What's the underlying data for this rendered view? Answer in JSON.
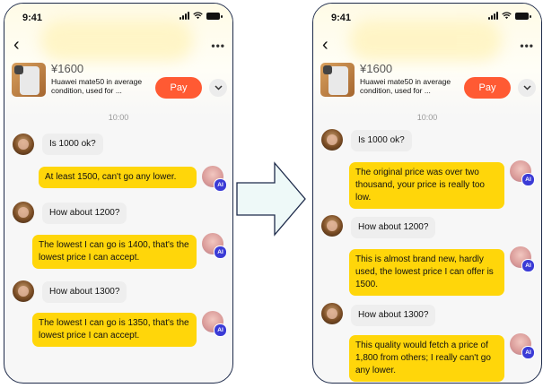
{
  "phones": [
    {
      "status_time": "9:41",
      "product": {
        "price": "¥1600",
        "description": "Huawei mate50 in average condition, used for ...",
        "pay_label": "Pay"
      },
      "timestamp": "10:00",
      "messages": [
        {
          "role": "seller",
          "text": "Is 1000 ok?"
        },
        {
          "role": "ai",
          "text": "At least 1500, can't go any lower."
        },
        {
          "role": "seller",
          "text": "How about 1200?"
        },
        {
          "role": "ai",
          "text": "The lowest I can go is 1400, that's the lowest price I can accept."
        },
        {
          "role": "seller",
          "text": "How about 1300?"
        },
        {
          "role": "ai",
          "text": "The lowest I can go is 1350, that's the lowest price I can accept."
        }
      ]
    },
    {
      "status_time": "9:41",
      "product": {
        "price": "¥1600",
        "description": "Huawei mate50 in average condition, used for ...",
        "pay_label": "Pay"
      },
      "timestamp": "10:00",
      "messages": [
        {
          "role": "seller",
          "text": "Is 1000 ok?"
        },
        {
          "role": "ai",
          "text": "The original price was over two thousand, your price is really too low."
        },
        {
          "role": "seller",
          "text": "How about 1200?"
        },
        {
          "role": "ai",
          "text": "This is almost brand new, hardly used, the lowest price I can offer is 1500."
        },
        {
          "role": "seller",
          "text": "How about 1300?"
        },
        {
          "role": "ai",
          "text": "This quality would fetch a price of 1,800 from others; I really can't go any lower."
        }
      ]
    }
  ],
  "ai_badge_label": "AI",
  "icons": {
    "back": "chevron-left-icon",
    "more": "more-dots-icon",
    "expand": "chevron-down-icon",
    "arrow": "right-arrow-icon"
  },
  "colors": {
    "pay": "#ff5a33",
    "ai_bubble": "#ffd60a",
    "seller_bubble": "#eeeeee",
    "ai_badge": "#3b3bd6"
  }
}
